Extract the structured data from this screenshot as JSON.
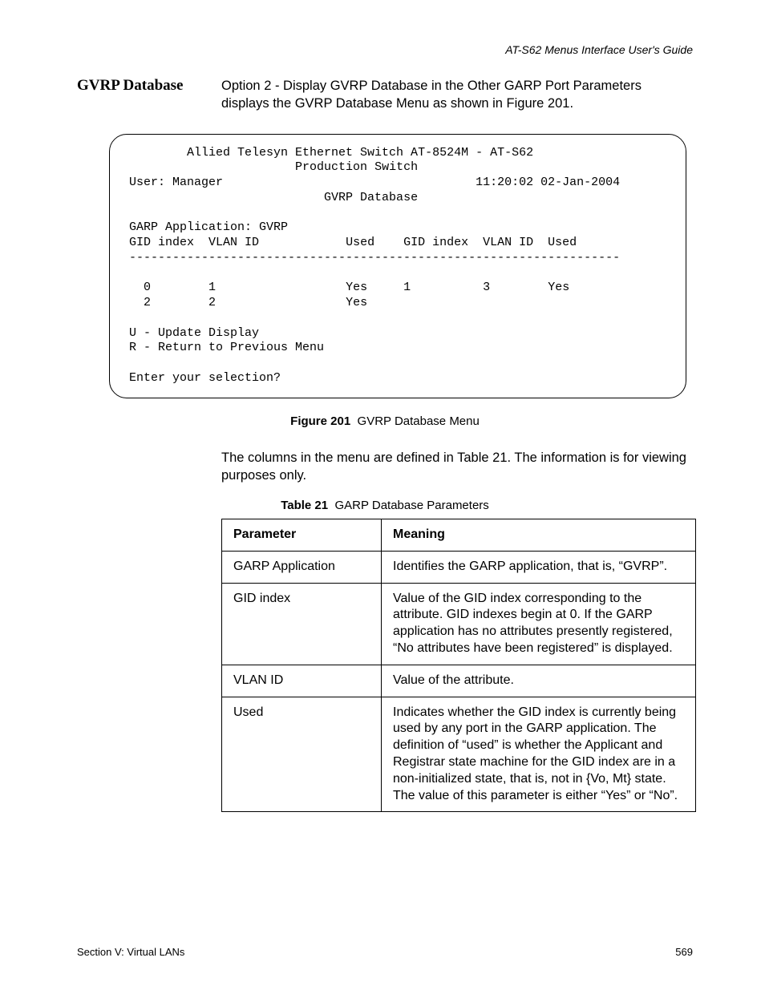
{
  "header": {
    "running": "AT-S62 Menus Interface User's Guide"
  },
  "section": {
    "label": "GVRP Database",
    "intro": "Option 2 - Display GVRP Database in the Other GARP Port Parameters displays the GVRP Database Menu as shown in Figure 201."
  },
  "terminal": {
    "title_line": "Allied Telesyn Ethernet Switch AT-8524M - AT-S62",
    "subtitle_line": "Production Switch",
    "user_label": "User: Manager",
    "timestamp": "11:20:02 02-Jan-2004",
    "screen_title": "GVRP Database",
    "garp_app": "GARP Application: GVRP",
    "headers": {
      "gid_index": "GID index",
      "vlan_id": "VLAN ID",
      "used": "Used"
    },
    "divider": "--------------------------------------------------------------------",
    "rows": [
      {
        "c1": "0",
        "c2": "1",
        "c3": "Yes",
        "c4": "1",
        "c5": "3",
        "c6": "Yes"
      },
      {
        "c1": "2",
        "c2": "2",
        "c3": "Yes",
        "c4": "",
        "c5": "",
        "c6": ""
      }
    ],
    "opt_u": "U - Update Display",
    "opt_r": "R - Return to Previous Menu",
    "prompt": "Enter your selection?"
  },
  "figure": {
    "label": "Figure 201",
    "text": "GVRP Database Menu"
  },
  "post_figure": "The columns in the menu are defined in Table 21. The information is for viewing purposes only.",
  "table_caption": {
    "label": "Table 21",
    "text": "GARP Database Parameters"
  },
  "table": {
    "head": {
      "param": "Parameter",
      "meaning": "Meaning"
    },
    "rows": [
      {
        "param": "GARP Application",
        "meaning": "Identifies the GARP application, that is, “GVRP”."
      },
      {
        "param": "GID index",
        "meaning": "Value of the GID index corresponding to the attribute. GID indexes begin at 0. If the GARP application has no attributes presently registered, “No attributes have been registered” is displayed."
      },
      {
        "param": "VLAN ID",
        "meaning": "Value of the attribute."
      },
      {
        "param": "Used",
        "meaning": "Indicates whether the GID index is currently being used by any port in the GARP application. The definition of “used” is whether the Applicant and Registrar state machine for the GID index are in a non-initialized state, that is, not in {Vo, Mt} state. The value of this parameter is either “Yes” or “No”."
      }
    ]
  },
  "footer": {
    "left": "Section V: Virtual LANs",
    "right": "569"
  }
}
